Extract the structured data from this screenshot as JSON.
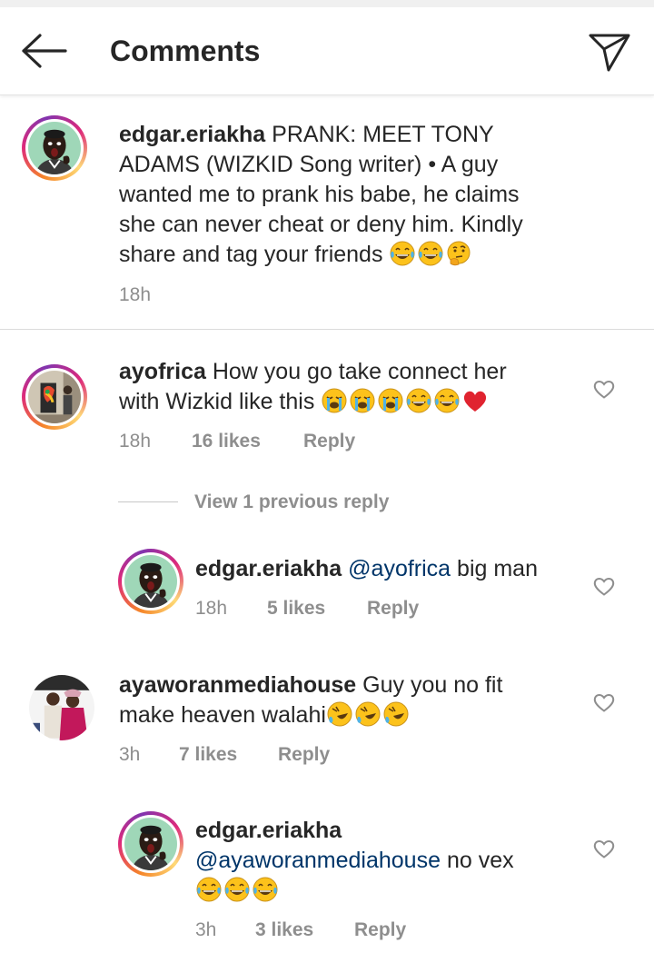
{
  "header": {
    "title": "Comments",
    "back_icon": "arrow-left-icon",
    "send_icon": "paper-plane-icon"
  },
  "caption": {
    "username": "edgar.eriakha",
    "lines": [
      "PRANK: MEET TONY",
      "ADAMS (WIZKID Song writer) • A guy",
      "wanted me to prank his babe, he claims",
      "she can never cheat or deny him. Kindly",
      "share and tag your friends"
    ],
    "emojis": [
      "joy",
      "joy",
      "thinking"
    ],
    "time": "18h"
  },
  "comments": [
    {
      "username": "ayofrica",
      "line1": "How you go take connect her",
      "line2": "with Wizkid like this",
      "emojis": [
        "sob",
        "sob",
        "sob",
        "joy",
        "joy",
        "heart"
      ],
      "time": "18h",
      "likes": "16 likes",
      "reply": "Reply",
      "view_replies": "View 1 previous reply"
    },
    {
      "username": "edgar.eriakha",
      "mention": "@ayofrica",
      "text": "big man",
      "time": "18h",
      "likes": "5 likes",
      "reply": "Reply"
    },
    {
      "username": "ayaworanmediahouse",
      "line1": "Guy you no fit",
      "line2": "make heaven walahi",
      "emojis": [
        "rofl",
        "rofl",
        "rofl"
      ],
      "time": "3h",
      "likes": "7 likes",
      "reply": "Reply"
    },
    {
      "username": "edgar.eriakha",
      "mention": "@ayaworanmediahouse",
      "text": "no vex",
      "emojis": [
        "joy",
        "joy",
        "joy"
      ],
      "time": "3h",
      "likes": "3 likes",
      "reply": "Reply"
    }
  ],
  "colors": {
    "mention": "#003569",
    "meta": "#8e8e8e",
    "text": "#262626",
    "heart": "#e0232f"
  }
}
